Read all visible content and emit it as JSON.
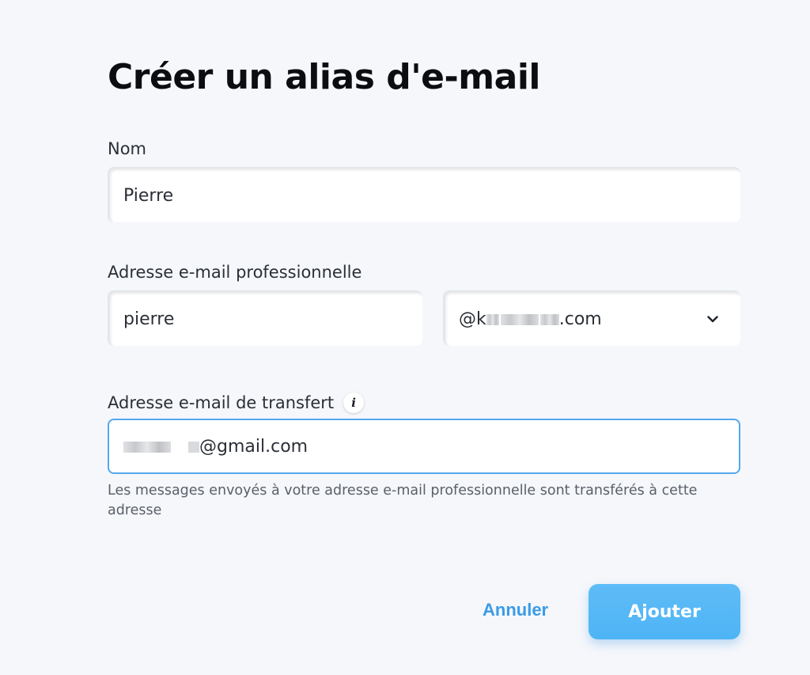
{
  "page": {
    "title": "Créer un alias d'e-mail"
  },
  "form": {
    "name": {
      "label": "Nom",
      "value": "Pierre"
    },
    "business_email": {
      "label": "Adresse e-mail professionnelle",
      "local_part": "pierre",
      "domain_prefix": "@k",
      "domain_suffix": ".com"
    },
    "forward_email": {
      "label": "Adresse e-mail de transfert",
      "value_suffix": "@gmail.com",
      "help": "Les messages envoyés à votre adresse e-mail professionnelle sont transférés à cette adresse"
    }
  },
  "actions": {
    "cancel_label": "Annuler",
    "add_label": "Ajouter"
  },
  "icons": {
    "info": "info-icon",
    "dropdown": "chevron-down-icon"
  },
  "colors": {
    "accent": "#4eb4f5",
    "focus_border": "#55a7ec",
    "link": "#3a9be8"
  }
}
